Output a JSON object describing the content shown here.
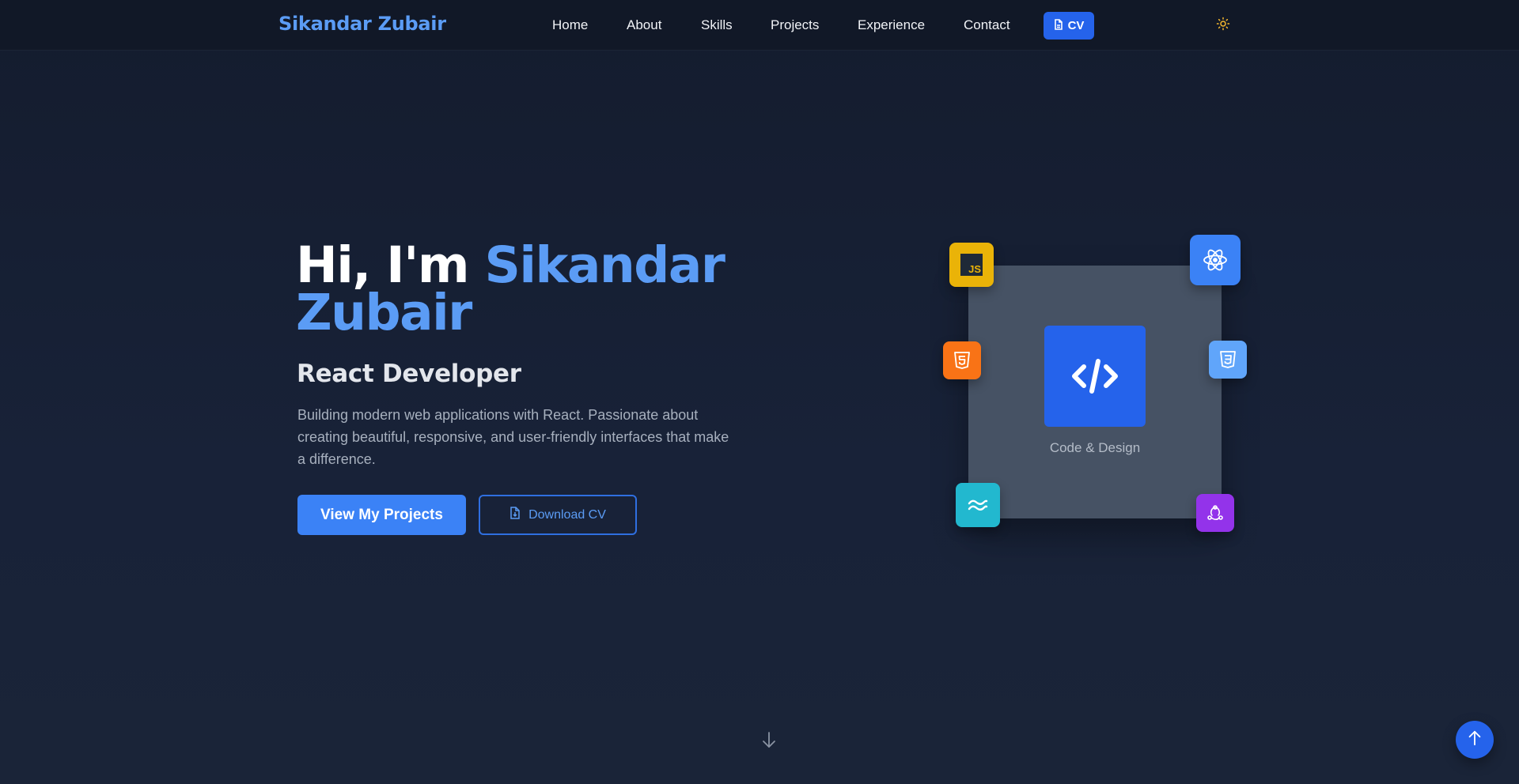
{
  "nav": {
    "brand": "Sikandar Zubair",
    "links": [
      "Home",
      "About",
      "Skills",
      "Projects",
      "Experience",
      "Contact"
    ],
    "cv_label": "CV",
    "theme_toggle_icon": "sun-icon"
  },
  "hero": {
    "greeting": "Hi, I'm",
    "name": "Sikandar Zubair",
    "role": "React Developer",
    "description": "Building modern web applications with React. Passionate about creating beautiful, responsive, and user-friendly interfaces that make a difference.",
    "primary_button": "View My Projects",
    "secondary_button": "Download CV"
  },
  "graphic": {
    "caption": "Code & Design",
    "center_icon": "code-icon",
    "tech_icons": [
      {
        "name": "javascript-icon",
        "label": "JS",
        "color": "#eab308"
      },
      {
        "name": "react-icon",
        "color": "#3b82f6"
      },
      {
        "name": "html5-icon",
        "color": "#f97316"
      },
      {
        "name": "css3-icon",
        "color": "#60a5fa"
      },
      {
        "name": "tailwind-icon",
        "color": "#22b8cf"
      },
      {
        "name": "redux-icon",
        "color": "#9333ea"
      }
    ]
  },
  "colors": {
    "accent": "#5b9cf5",
    "primary_button": "#3b82f6",
    "cv_button": "#2563eb",
    "background": "#182238",
    "navbar": "#111827"
  },
  "scroll_down_icon": "arrow-down-icon",
  "back_to_top_icon": "arrow-up-icon"
}
